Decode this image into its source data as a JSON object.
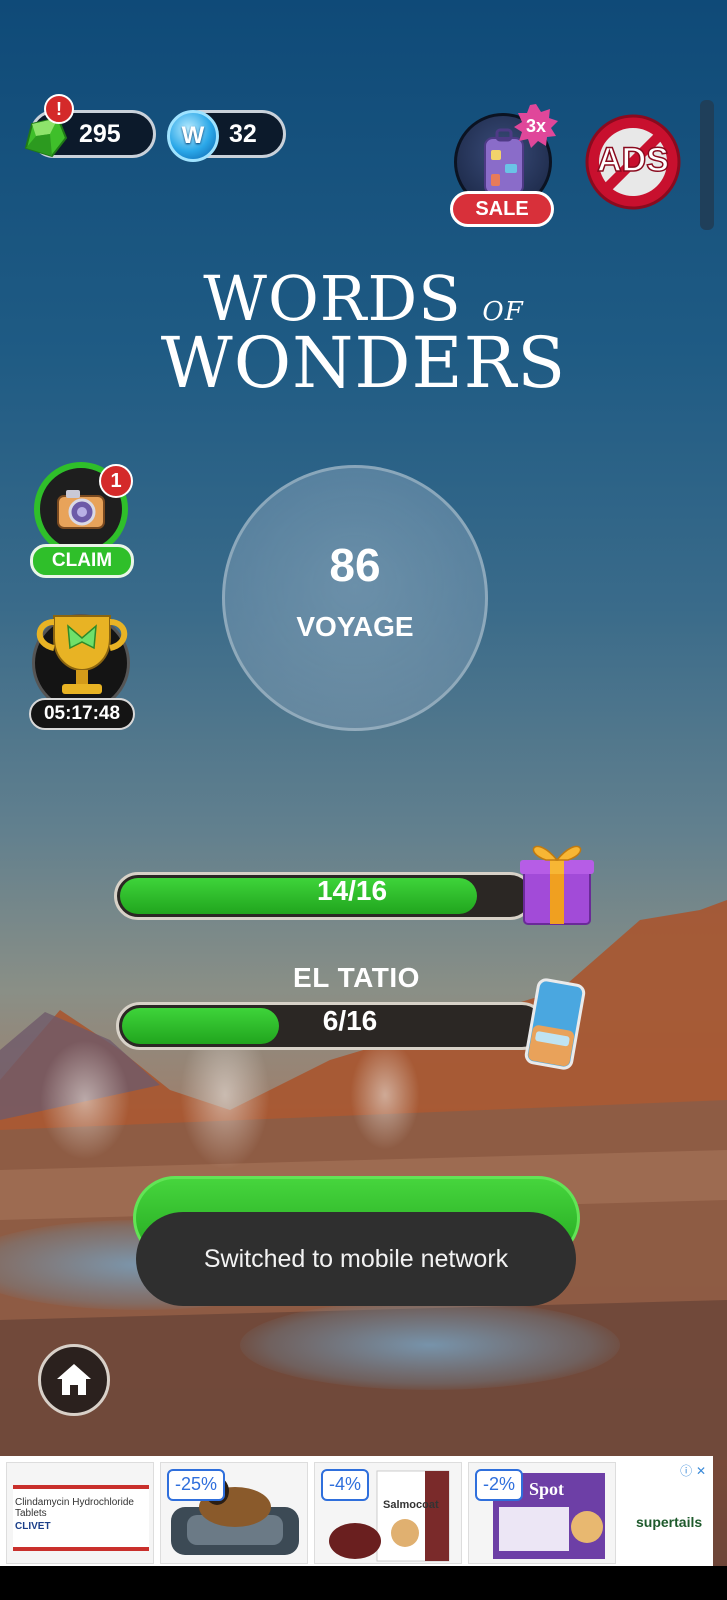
{
  "currency": {
    "gems": "295",
    "gem_alert": "!",
    "coin_symbol": "W",
    "coins": "32"
  },
  "shop": {
    "multiplier": "3x",
    "sale_label": "SALE",
    "remove_ads_label": "ADS"
  },
  "title": {
    "line1_main": "WORDS",
    "line1_small": "OF",
    "line2": "WONDERS"
  },
  "side": {
    "album_badge": "1",
    "claim_label": "CLAIM",
    "event_timer": "05:17:48"
  },
  "level": {
    "number": "86",
    "name": "VOYAGE"
  },
  "progress": {
    "gift_progress_text": "14/16",
    "gift_progress_fraction": 0.875,
    "next_location": "EL TATIO",
    "location_progress_text": "6/16",
    "location_progress_fraction": 0.375
  },
  "toast": {
    "message": "Switched to mobile network"
  },
  "ad_banner": {
    "card1_text": "Clindamycin Hydrochloride Tablets",
    "card1_brand": "CLIVET",
    "card2_discount": "-25%",
    "card3_discount": "-4%",
    "card3_product": "Salmocoat",
    "card4_discount": "-2%",
    "card4_product": "Spot",
    "sponsor": "supertails"
  },
  "colors": {
    "progress_green": "#2fc12b",
    "sale_red": "#d8303a",
    "sky_top": "#0f4a78"
  }
}
